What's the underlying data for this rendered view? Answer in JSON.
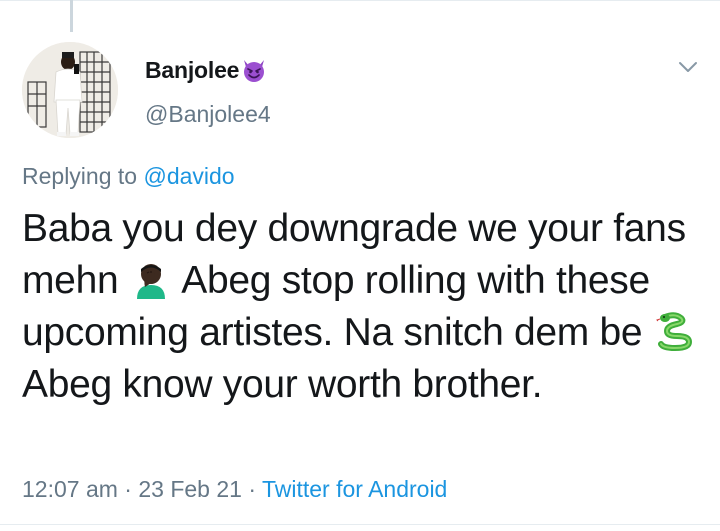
{
  "tweet": {
    "display_name": "Banjolee",
    "name_emoji": "smiling-devil-emoji",
    "handle": "@Banjolee4",
    "replying_prefix": "Replying to ",
    "replying_to": "@davido",
    "text": {
      "part1": "Baba you dey downgrade we your fans mehn",
      "emoji1": "facepalm-emoji",
      "part2": " Abeg stop rolling with these upcoming artistes. Na snitch dem be",
      "emoji2": "snake-emoji",
      "part3": " Abeg know your worth brother."
    },
    "time": "12:07 am",
    "separator1": " · ",
    "date": "23 Feb 21",
    "separator2": " · ",
    "source": "Twitter for Android"
  },
  "icons": {
    "menu": "chevron-down-icon"
  },
  "colors": {
    "text": "#14171a",
    "secondary": "#657786",
    "link": "#1b95e0",
    "border": "#e6ecf0"
  }
}
